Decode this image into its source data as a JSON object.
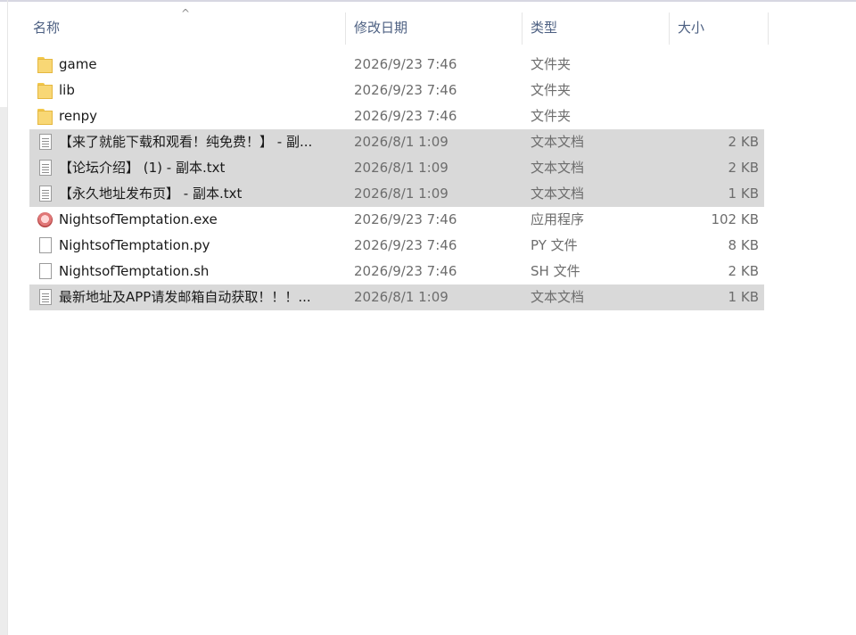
{
  "header": {
    "name": "名称",
    "date": "修改日期",
    "type": "类型",
    "size": "大小"
  },
  "files": [
    {
      "name": "game",
      "date": "2026/9/23 7:46",
      "type": "文件夹",
      "size": "",
      "icon": "folder-icon",
      "selected": false
    },
    {
      "name": "lib",
      "date": "2026/9/23 7:46",
      "type": "文件夹",
      "size": "",
      "icon": "folder-icon",
      "selected": false
    },
    {
      "name": "renpy",
      "date": "2026/9/23 7:46",
      "type": "文件夹",
      "size": "",
      "icon": "folder-icon",
      "selected": false
    },
    {
      "name": "【来了就能下载和观看！纯免费！】 - 副...",
      "date": "2026/8/1 1:09",
      "type": "文本文档",
      "size": "2 KB",
      "icon": "text-document-icon",
      "selected": true
    },
    {
      "name": "【论坛介绍】 (1) - 副本.txt",
      "date": "2026/8/1 1:09",
      "type": "文本文档",
      "size": "2 KB",
      "icon": "text-document-icon",
      "selected": true
    },
    {
      "name": "【永久地址发布页】  - 副本.txt",
      "date": "2026/8/1 1:09",
      "type": "文本文档",
      "size": "1 KB",
      "icon": "text-document-icon",
      "selected": true
    },
    {
      "name": "NightsofTemptation.exe",
      "date": "2026/9/23 7:46",
      "type": "应用程序",
      "size": "102 KB",
      "icon": "application-icon",
      "selected": false
    },
    {
      "name": "NightsofTemptation.py",
      "date": "2026/9/23 7:46",
      "type": "PY 文件",
      "size": "8 KB",
      "icon": "file-icon",
      "selected": false
    },
    {
      "name": "NightsofTemptation.sh",
      "date": "2026/9/23 7:46",
      "type": "SH 文件",
      "size": "2 KB",
      "icon": "file-icon",
      "selected": false
    },
    {
      "name": "最新地址及APP请发邮箱自动获取！！！...",
      "date": "2026/8/1 1:09",
      "type": "文本文档",
      "size": "1 KB",
      "icon": "text-document-icon",
      "selected": true
    }
  ]
}
